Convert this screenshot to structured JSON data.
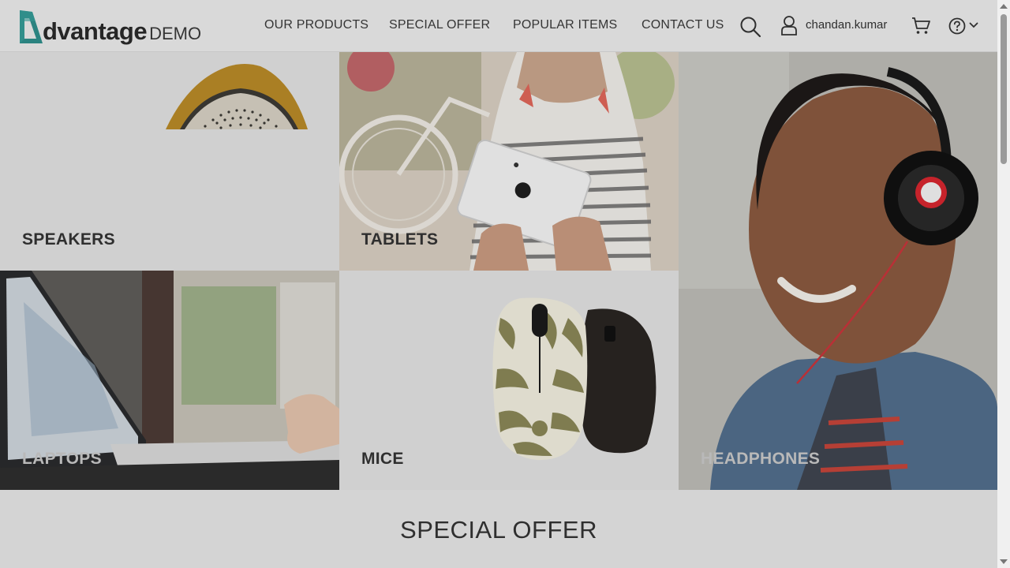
{
  "brand": {
    "word": "dvantage",
    "suffix": "DEMO",
    "accent": "#2f8f8b"
  },
  "nav": {
    "items": [
      "OUR PRODUCTS",
      "SPECIAL OFFER",
      "POPULAR ITEMS",
      "CONTACT US"
    ]
  },
  "user": {
    "name": "chandan.kumar"
  },
  "icons": {
    "search": "search-icon",
    "user": "user-icon",
    "cart": "cart-icon",
    "help": "help-icon",
    "chevron": "chevron-down-icon"
  },
  "categories": {
    "speakers": "SPEAKERS",
    "tablets": "TABLETS",
    "headphones": "HEADPHONES",
    "laptops": "LAPTOPS",
    "mice": "MICE"
  },
  "sections": {
    "special_offer": "SPECIAL OFFER"
  }
}
